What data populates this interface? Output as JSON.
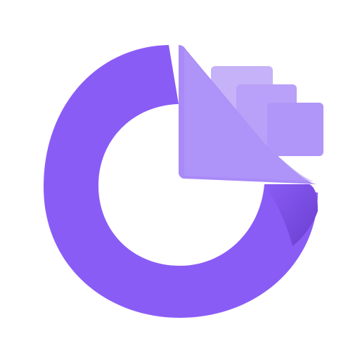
{
  "icon": {
    "name": "app-logo-icon",
    "colors": {
      "background": "#ffffff",
      "ring": "#8a5cf6",
      "ring_shadow": "#6c3fd6",
      "page_front": "#a98af8",
      "page_middle": "#b9a0f8",
      "page_back": "#c6b2f8"
    }
  }
}
